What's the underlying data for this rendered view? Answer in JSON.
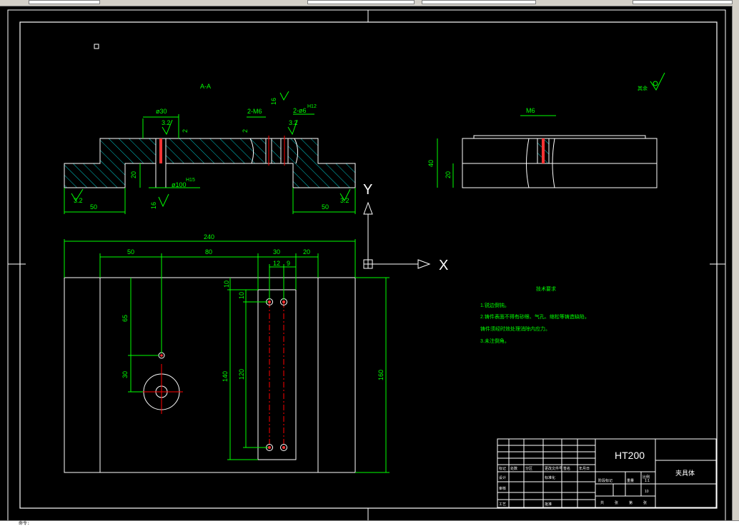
{
  "view": {
    "section_label": "A-A",
    "cursor_glyph": "□"
  },
  "dims": {
    "phi30": "ø30",
    "rough32_a": "3.2",
    "two_mm": "2",
    "two_m6": "2-M6",
    "sixteen_top": "16",
    "two_mm_b": "2",
    "two_phi": "2-ø6",
    "phi_tol": "H12",
    "rough32_b": "3.2",
    "twenty": "20",
    "phi100": "ø100",
    "phi100_tol": "H15",
    "sixteen_bottom": "16",
    "rough32_left": "3.2",
    "fifty_left": "50",
    "fifty_right": "50",
    "rough32_right": "3.2",
    "m6_side": "M6",
    "forty_side": "40",
    "twenty_side": "20",
    "plan_240": "240",
    "plan_50": "50",
    "plan_80": "80",
    "plan_30": "30",
    "plan_20": "20",
    "plan_12": "12",
    "plan_9": "9",
    "plan_10a": "10",
    "plan_10b": "10",
    "plan_65": "65",
    "plan_30v": "30",
    "plan_140": "140",
    "plan_120": "120",
    "plan_160": "160"
  },
  "ucs": {
    "y_label": "Y",
    "x_label": "X"
  },
  "notes": {
    "roughness_rest": "其余",
    "title": "技术要求",
    "line1": "1.锐边倒钝。",
    "line2a": "2.铸件表面不得有砂眼、气孔、缩松等铸造缺陷，",
    "line2b": "铸件须经时效处理消除内应力。",
    "line3": "3.未注倒角。"
  },
  "title_block": {
    "material": "HT200",
    "part_name": "夹具体",
    "scale": "1:1",
    "sheet_no": "10",
    "row_a": [
      "标记",
      "处数",
      "分区",
      "更改文件号",
      "签名",
      "年月日"
    ],
    "row_b": [
      "设计",
      "",
      "标准化"
    ],
    "row_c": [
      "审核"
    ],
    "row_d": [
      "工艺",
      "",
      "批准"
    ],
    "stage_labels": [
      "阶段标记",
      "重量",
      "比例"
    ],
    "sheet_labels": [
      "共",
      "张",
      "第",
      "张"
    ]
  },
  "cmdline": {
    "text": "命令:"
  },
  "colors": {
    "dimension": "#00ff00",
    "outline": "#ffffff",
    "centerline": "#ff0000",
    "hatch": "#00ffff",
    "background": "#000000"
  }
}
